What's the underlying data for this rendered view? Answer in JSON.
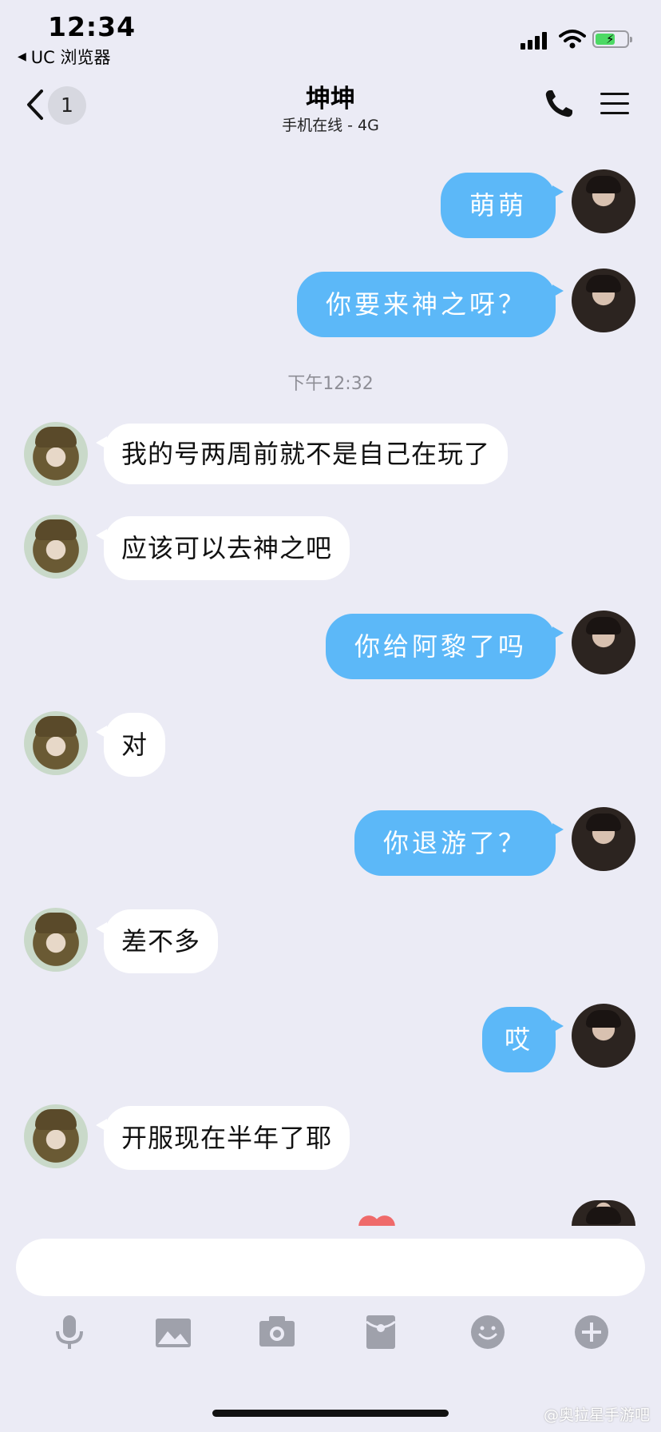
{
  "status": {
    "time": "12:34",
    "back_app": "UC 浏览器"
  },
  "header": {
    "unread_badge": "1",
    "title": "坤坤",
    "subtitle": "手机在线 - 4G"
  },
  "messages": [
    {
      "side": "out",
      "text": "萌萌"
    },
    {
      "side": "out",
      "text": "你要来神之呀？"
    },
    {
      "side": "in",
      "text": "我的号两周前就不是自己在玩了"
    },
    {
      "side": "in",
      "text": "应该可以去神之吧"
    },
    {
      "side": "out",
      "text": "你给阿黎了吗"
    },
    {
      "side": "in",
      "text": "对"
    },
    {
      "side": "out",
      "text": "你退游了？"
    },
    {
      "side": "in",
      "text": "差不多"
    },
    {
      "side": "out",
      "text": "哎"
    },
    {
      "side": "in",
      "text": "开服现在半年了耶"
    }
  ],
  "timestamp": "下午12:32",
  "toolbar_icons": [
    "microphone-icon",
    "image-icon",
    "camera-icon",
    "red-envelope-icon",
    "emoji-icon",
    "plus-icon"
  ],
  "colors": {
    "outgoing_bubble": "#5cb8f8",
    "incoming_bubble": "#ffffff",
    "background": "#ebebf5"
  },
  "watermark": "@奥拉星手游吧"
}
